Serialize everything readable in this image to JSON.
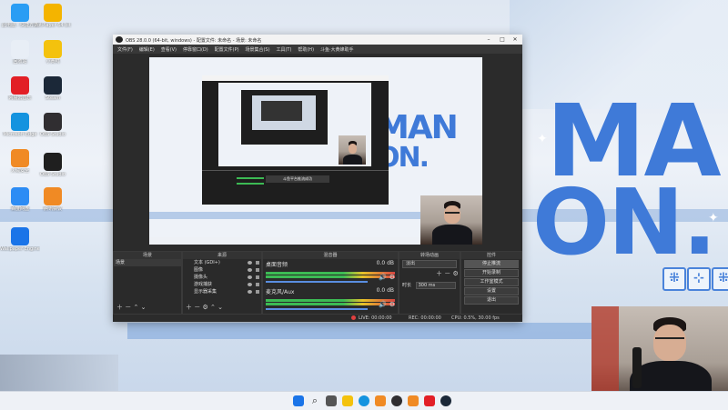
{
  "wallpaper": {
    "big_text_1": "MAN",
    "big_text_2": "ON.",
    "big_text_3": "MAN",
    "big_text_4": "ON.",
    "symbols": [
      "⁜",
      "⊹",
      "⁜"
    ]
  },
  "desktop_icons": [
    {
      "label": "此电脑 - 快捷方式",
      "color": "#2a9df4",
      "icon": "computer-icon"
    },
    {
      "label": "PotPlayer 64 bit",
      "color": "#f4b400",
      "icon": "potplayer-icon"
    },
    {
      "label": "回收站",
      "color": "#e8eef6",
      "icon": "recycle-bin-icon"
    },
    {
      "label": "小黄鸭",
      "color": "#f4c20d",
      "icon": "duck-icon"
    },
    {
      "label": "网易云音乐",
      "color": "#e21f26",
      "icon": "netease-music-icon"
    },
    {
      "label": "Steam",
      "color": "#1b2838",
      "icon": "steam-icon"
    },
    {
      "label": "Microsoft Edge",
      "color": "#1493df",
      "icon": "edge-icon"
    },
    {
      "label": "OBS Studio",
      "color": "#302e31",
      "icon": "obs-icon"
    },
    {
      "label": "火绒安全",
      "color": "#f08a24",
      "icon": "huorong-icon"
    },
    {
      "label": "OBS Studio",
      "color": "#1f1f1f",
      "icon": "obs-icon"
    },
    {
      "label": "百度网盘",
      "color": "#2c8cf4",
      "icon": "baidu-netdisk-icon"
    },
    {
      "label": "腾讯会议",
      "color": "#f08a24",
      "icon": "meeting-icon"
    },
    {
      "label": "Wallpaper Engine",
      "color": "#1a74e8",
      "icon": "wallpaper-engine-icon"
    }
  ],
  "obs": {
    "title": "OBS 28.0.0 (64-bit, windows) - 配置文件: 未命名 - 场景: 未命名",
    "menu": [
      "文件(F)",
      "编辑(E)",
      "查看(V)",
      "停靠窗口(D)",
      "配置文件(P)",
      "场景集合(S)",
      "工具(T)",
      "帮助(H)",
      "斗鱼·大黄蜂助手"
    ],
    "inner_caption": "斗鱼平台推流成功",
    "docks": {
      "scenes": {
        "title": "场景",
        "items": [
          "场景"
        ]
      },
      "sources": {
        "title": "来源",
        "items": [
          "文本 (GDI+)",
          "图像",
          "摄像头",
          "游戏捕获",
          "显示器采集"
        ]
      },
      "mixer": {
        "title": "混音器",
        "channels": [
          {
            "name": "桌面音频",
            "db": "0.0 dB"
          },
          {
            "name": "麦克风/Aux",
            "db": "0.0 dB"
          }
        ]
      },
      "transitions": {
        "title": "转场动画",
        "type": "淡出",
        "duration_label": "时长",
        "duration": "300 ms"
      },
      "controls": {
        "title": "控件",
        "buttons": [
          "停止推流",
          "开始录制",
          "工作室模式",
          "设置",
          "退出"
        ]
      }
    },
    "status": {
      "live": "LIVE: 00:00:00",
      "rec": "REC: 00:00:00",
      "cpu": "CPU: 0.5%, 30.00 fps"
    }
  }
}
